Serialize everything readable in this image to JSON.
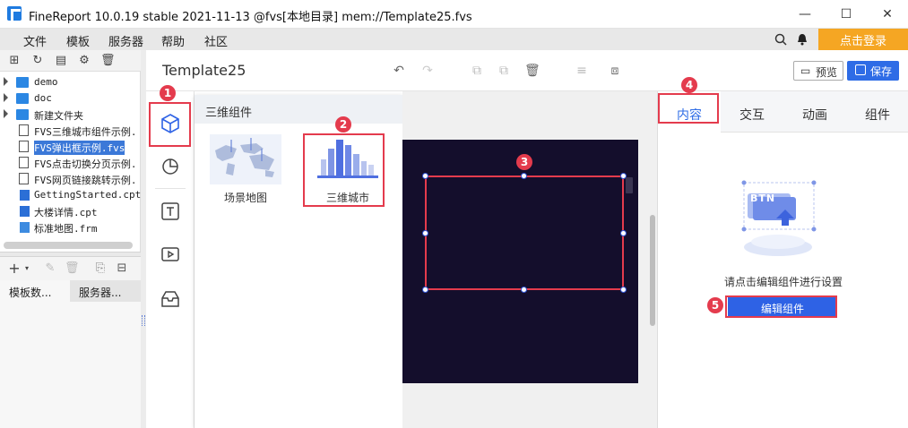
{
  "window": {
    "title": "FineReport 10.0.19 stable 2021-11-13 @fvs[本地目录]      mem://Template25.fvs",
    "minimize": "—",
    "maximize": "☐",
    "close": "✕"
  },
  "menu": {
    "items": [
      "文件",
      "模板",
      "服务器",
      "帮助",
      "社区"
    ],
    "search_icon": "search-icon",
    "bell_icon": "bell-icon",
    "login_label": "点击登录",
    "login_color": "#f5a623"
  },
  "file_tree": {
    "items": [
      {
        "name": "demo",
        "type": "folder"
      },
      {
        "name": "doc",
        "type": "folder"
      },
      {
        "name": "新建文件夹",
        "type": "folder"
      },
      {
        "name": "FVS三维城市组件示例.",
        "type": "fvs"
      },
      {
        "name": "FVS弹出框示例.fvs",
        "type": "fvs",
        "selected": true
      },
      {
        "name": "FVS点击切换分页示例.",
        "type": "fvs"
      },
      {
        "name": "FVS网页链接跳转示例.",
        "type": "fvs"
      },
      {
        "name": "GettingStarted.cpt",
        "type": "cpt"
      },
      {
        "name": "大楼详情.cpt",
        "type": "cpt"
      },
      {
        "name": "标准地图.frm",
        "type": "frm"
      }
    ],
    "bottom_tabs": [
      "模板数...",
      "服务器..."
    ]
  },
  "editor": {
    "template_name": "Template25",
    "preview_label": "预览",
    "save_label": "保存",
    "accent_color": "#2e6ce6"
  },
  "components_panel": {
    "title": "三维组件",
    "cards": [
      "场景地图",
      "三维城市"
    ]
  },
  "right_panel": {
    "tabs": [
      "内容",
      "交互",
      "动画",
      "组件"
    ],
    "active_tab": "内容",
    "illustration_text": "BTN",
    "hint": "请点击编辑组件进行设置",
    "edit_button": "编辑组件"
  },
  "annotations": {
    "badges": [
      "1",
      "2",
      "3",
      "4",
      "5"
    ],
    "color": "#e43b4d"
  }
}
